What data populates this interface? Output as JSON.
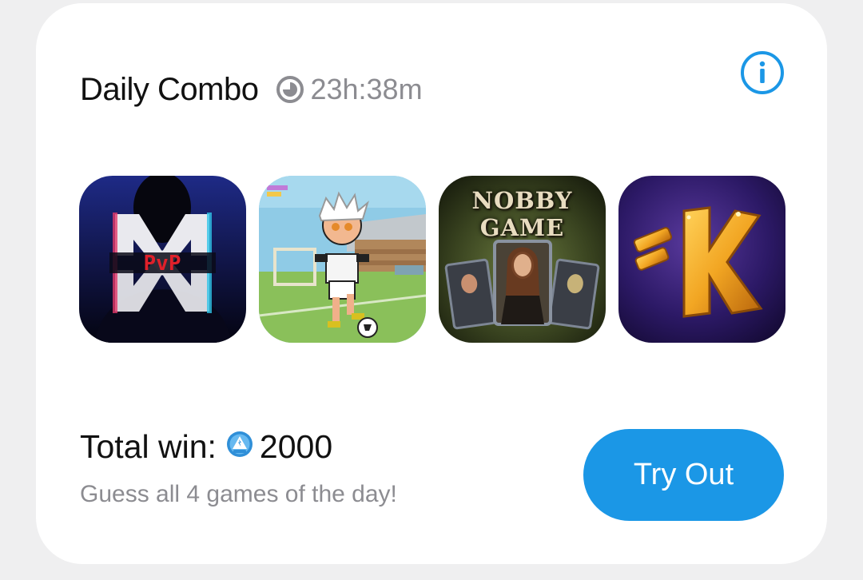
{
  "card": {
    "title": "Daily Combo",
    "timer": {
      "icon": "clock-icon",
      "value": "23h:38m"
    },
    "info_icon": "info-icon"
  },
  "games": [
    {
      "name": "PvP game tile",
      "icon": "pvp-logo",
      "label": "PvP"
    },
    {
      "name": "Pixel football game tile",
      "icon": "football-player"
    },
    {
      "name": "Nobby Game tile",
      "icon": "card-game",
      "label": "NOBBY GAME"
    },
    {
      "name": "K game tile",
      "icon": "letter-k-logo",
      "label": "K"
    }
  ],
  "total": {
    "label": "Total win:",
    "coin_icon": "point-coin-icon",
    "amount": "2000"
  },
  "subtitle": "Guess all 4 games of the day!",
  "cta": {
    "label": "Try Out"
  },
  "colors": {
    "accent": "#1b97e6",
    "text_primary": "#111111",
    "text_secondary": "#8c8c91",
    "background": "#efeff0",
    "card": "#ffffff"
  }
}
